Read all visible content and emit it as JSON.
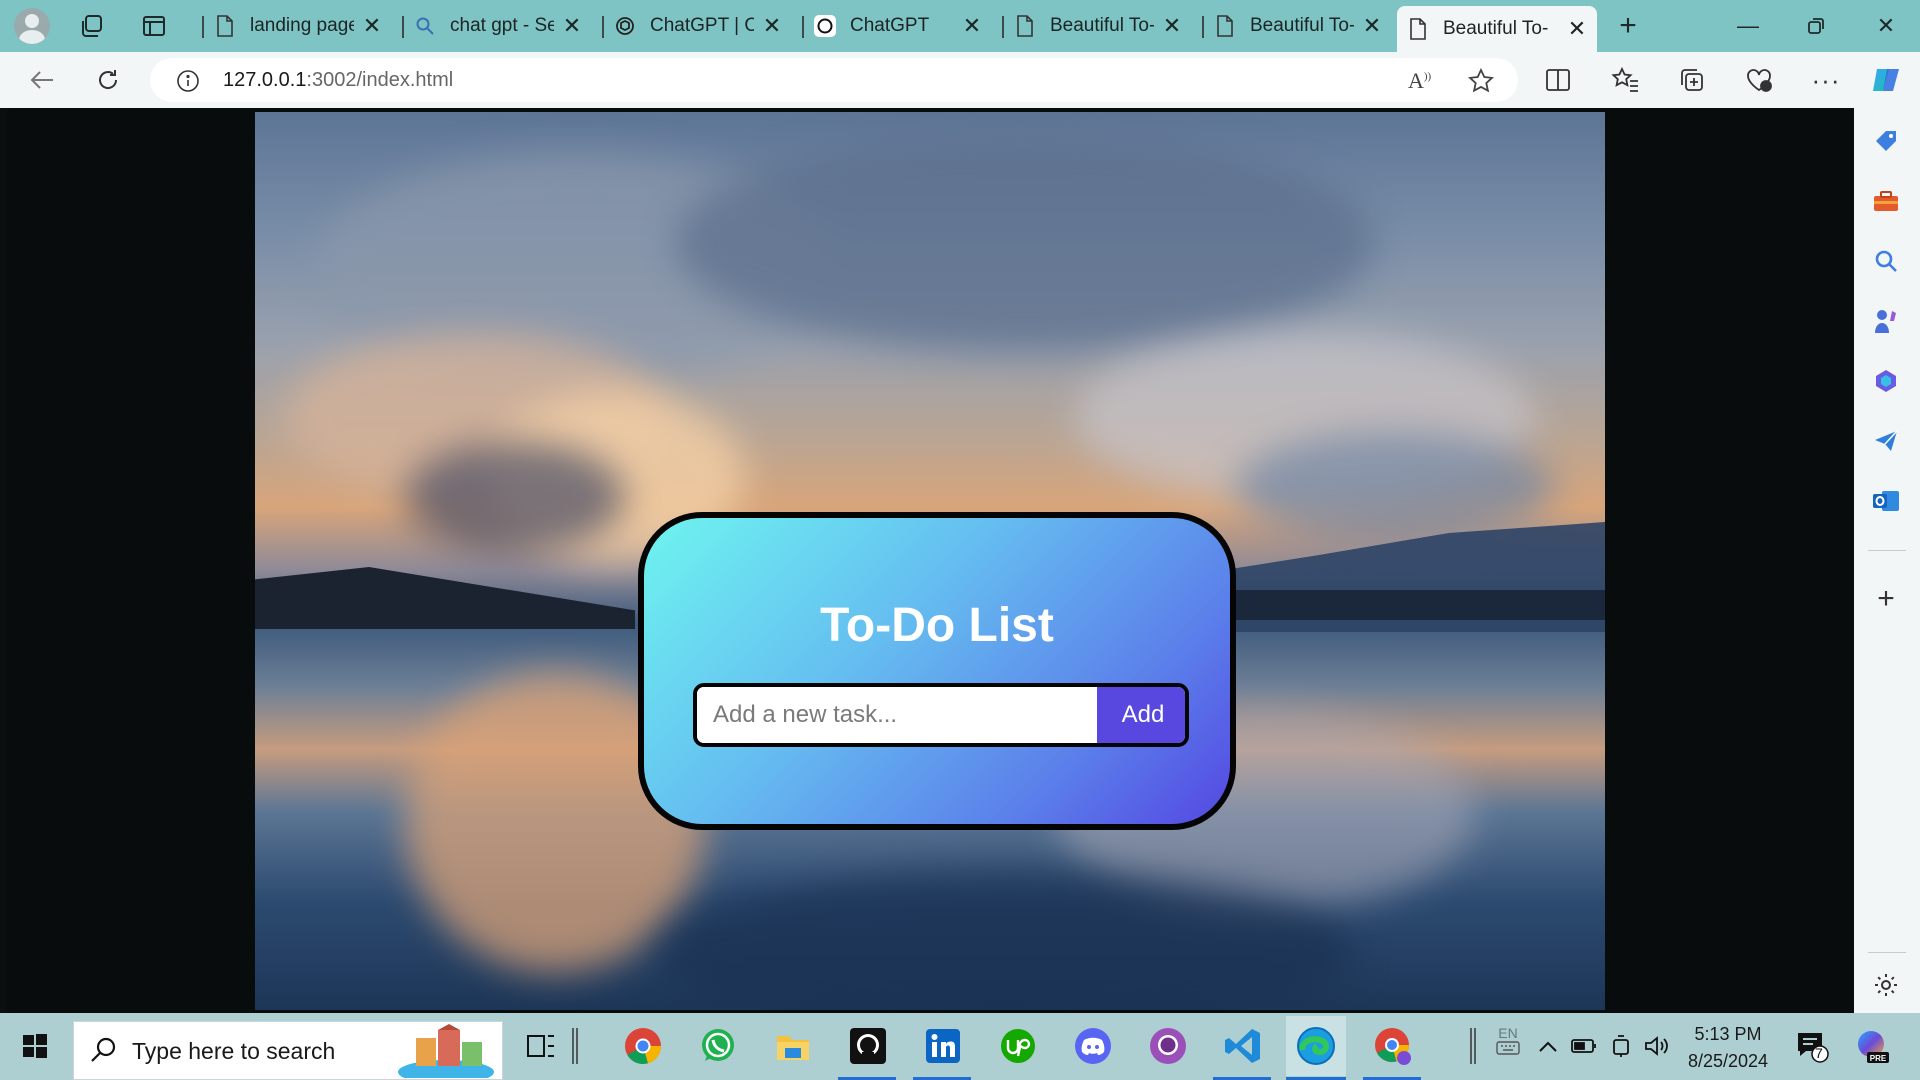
{
  "browser": {
    "tabs": [
      {
        "title": "landing page",
        "icon": "page-icon"
      },
      {
        "title": "chat gpt - Se",
        "icon": "search-icon"
      },
      {
        "title": "ChatGPT | Op",
        "icon": "openai-icon"
      },
      {
        "title": "ChatGPT",
        "icon": "openai-icon"
      },
      {
        "title": "Beautiful To-",
        "icon": "page-icon"
      },
      {
        "title": "Beautiful To-",
        "icon": "page-icon"
      },
      {
        "title": "Beautiful To-",
        "icon": "page-icon",
        "active": true
      }
    ],
    "address": {
      "host": "127.0.0.1",
      "path": ":3002/index.html"
    },
    "read_aloud_label": "A",
    "colors": {
      "tabbar": "#7fc4c4",
      "toolbar": "#f3f6f6"
    }
  },
  "todo": {
    "title": "To-Do List",
    "input_placeholder": "Add a new task...",
    "add_label": "Add",
    "colors": {
      "gradient_start": "#6ef4ef",
      "gradient_end": "#5448e2",
      "button": "#5848e0"
    }
  },
  "taskbar": {
    "search_placeholder": "Type here to search",
    "apps": [
      "task-view",
      "chrome",
      "whatsapp",
      "file-explorer",
      "github",
      "linkedin",
      "upwork",
      "discord",
      "github-desktop",
      "vscode",
      "edge",
      "chrome-profile"
    ],
    "lang": "EN",
    "time": "5:13 PM",
    "date": "8/25/2024",
    "notifications": "7"
  }
}
